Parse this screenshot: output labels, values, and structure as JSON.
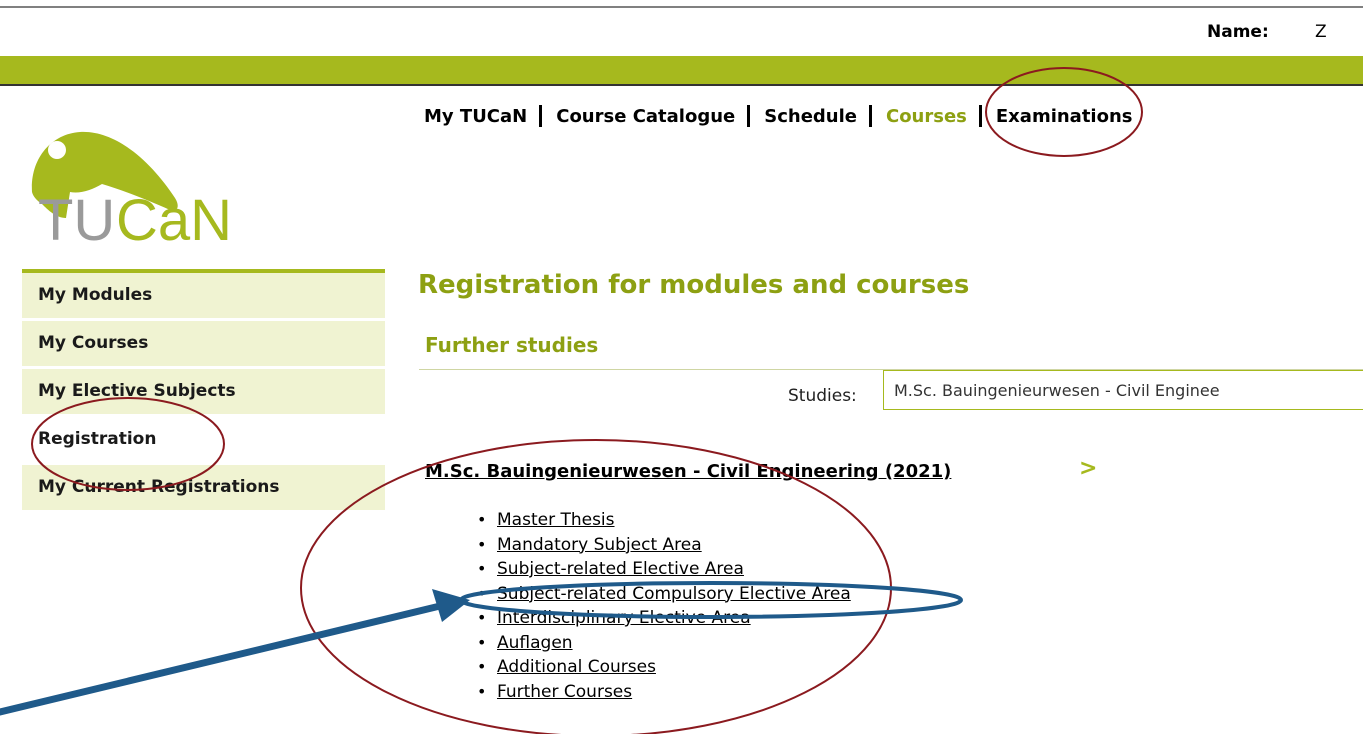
{
  "header": {
    "name_label": "Name:",
    "name_value": "Z"
  },
  "logo": {
    "text": "TUCaN"
  },
  "nav": {
    "items": [
      {
        "label": "My TUCaN"
      },
      {
        "label": "Course Catalogue"
      },
      {
        "label": "Schedule"
      },
      {
        "label": "Courses"
      },
      {
        "label": "Examinations"
      }
    ],
    "active": "Courses"
  },
  "sidebar": {
    "items": [
      {
        "label": "My Modules"
      },
      {
        "label": "My Courses"
      },
      {
        "label": "My Elective Subjects"
      },
      {
        "label": "Registration"
      },
      {
        "label": "My Current Registrations"
      }
    ],
    "active": "Registration"
  },
  "main": {
    "title": "Registration for modules and courses",
    "subtitle": "Further studies",
    "studies_label": "Studies:",
    "studies_value": "M.Sc. Bauingenieurwesen - Civil Enginee",
    "program_title": "M.Sc. Bauingenieurwesen - Civil Engineering (2021)",
    "program_arrow": ">",
    "areas": [
      {
        "label": "Master Thesis"
      },
      {
        "label": "Mandatory Subject Area"
      },
      {
        "label": "Subject-related Elective Area"
      },
      {
        "label": "Subject-related Compulsory Elective Area"
      },
      {
        "label": "Interdisciplinary Elective Area"
      },
      {
        "label": "Auflagen"
      },
      {
        "label": "Additional Courses"
      },
      {
        "label": "Further Courses"
      }
    ]
  },
  "colors": {
    "brand_green": "#a6b91e",
    "heading_green": "#8da012",
    "sidebar_bg": "#f0f3d2",
    "annotation_red": "#8b1a1f",
    "annotation_blue": "#1f5a8a"
  }
}
